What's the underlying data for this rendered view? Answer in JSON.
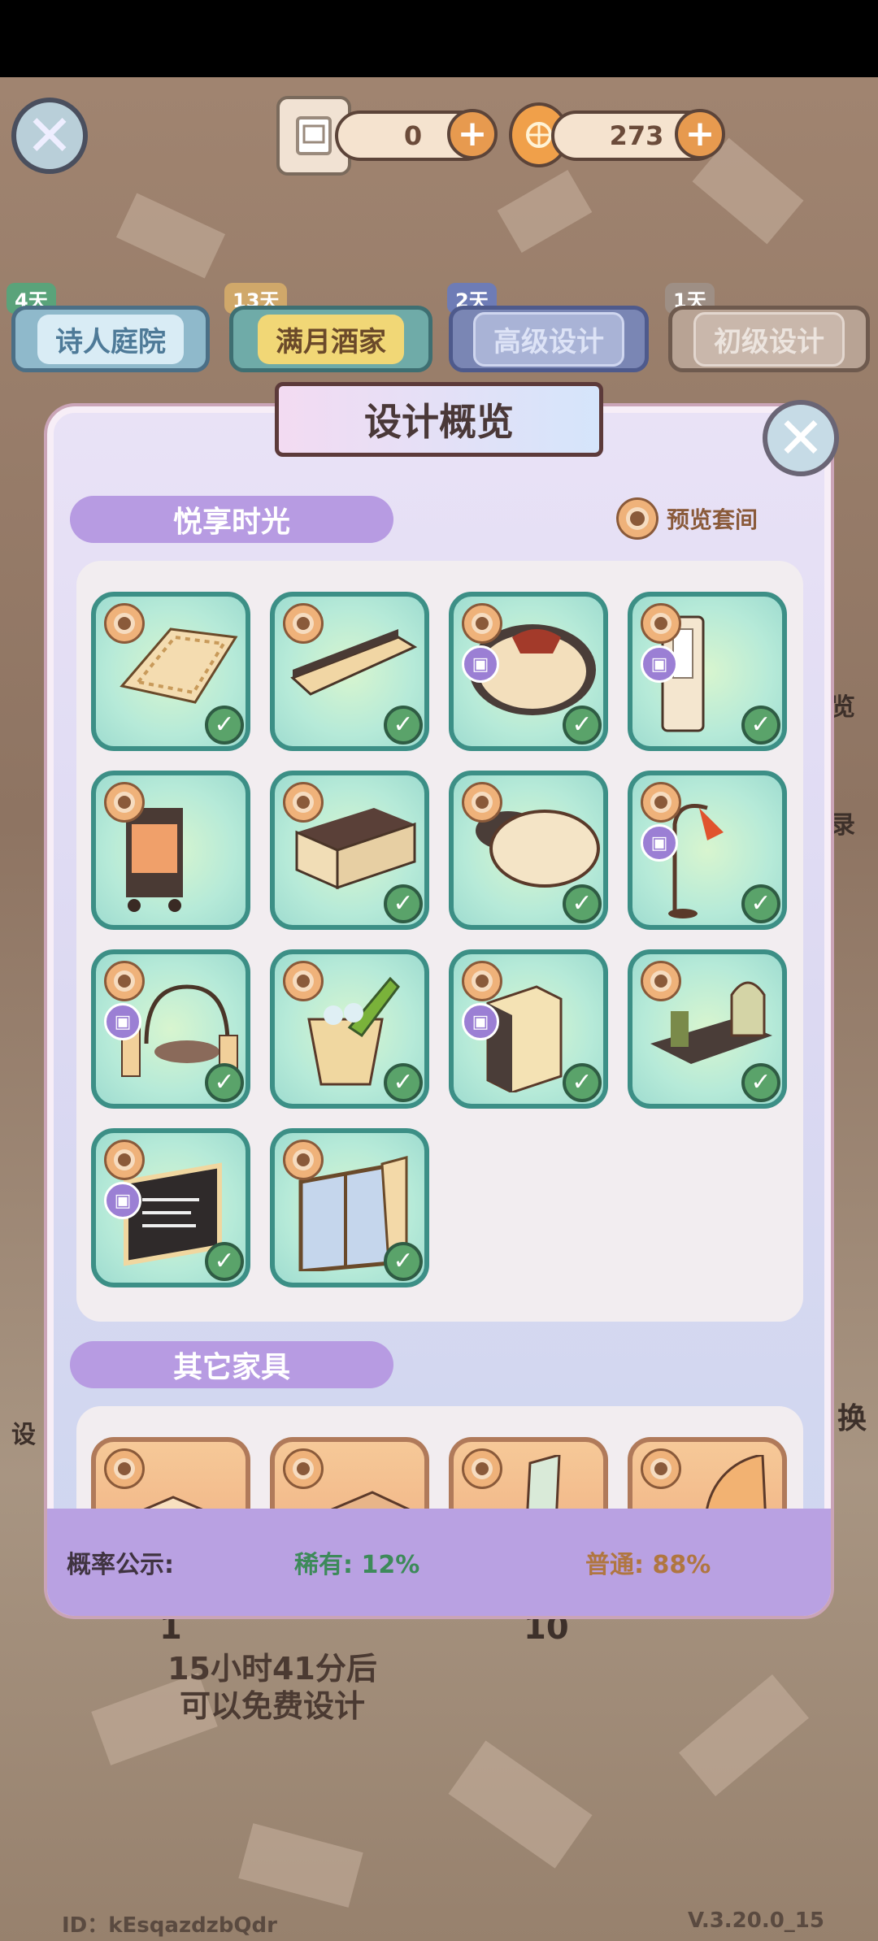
{
  "topbar": {
    "scroll_count": "0",
    "coin_count": "273",
    "close_icon": "close-icon",
    "plus_icon": "plus-icon"
  },
  "tabs": [
    {
      "label": "诗人庭院",
      "days": "4天"
    },
    {
      "label": "满月酒家",
      "days": "13天"
    },
    {
      "label": "高级设计",
      "days": "2天"
    },
    {
      "label": "初级设计",
      "days": "1天"
    }
  ],
  "modal": {
    "title": "设计概览",
    "section1": "悦享时光",
    "preview_label": "预览套间",
    "section2": "其它家具",
    "footer_label": "概率公示:",
    "rare_label": "稀有: 12%",
    "common_label": "普通: 88%"
  },
  "items": [
    {
      "name": "rug",
      "box": false,
      "check": true
    },
    {
      "name": "tv-cabinet",
      "box": false,
      "check": true
    },
    {
      "name": "round-bed",
      "box": true,
      "check": true
    },
    {
      "name": "air-conditioner",
      "box": true,
      "check": true
    },
    {
      "name": "serving-cart",
      "box": false,
      "check": false
    },
    {
      "name": "sideboard",
      "box": false,
      "check": true
    },
    {
      "name": "round-table",
      "box": false,
      "check": true
    },
    {
      "name": "floor-lamp",
      "box": true,
      "check": true
    },
    {
      "name": "candle-lantern",
      "box": true,
      "check": true
    },
    {
      "name": "champagne-bucket",
      "box": false,
      "check": true
    },
    {
      "name": "mini-fridge",
      "box": true,
      "check": true
    },
    {
      "name": "diffuser-tray",
      "box": false,
      "check": true
    },
    {
      "name": "menu-board",
      "box": true,
      "check": true
    },
    {
      "name": "window",
      "box": false,
      "check": true
    }
  ],
  "background": {
    "free_timer": "15小时41分后",
    "free_text": "可以免费设计",
    "count_1": "1",
    "count_10": "10",
    "side_right_1": "览",
    "side_right_2": "录",
    "side_right_3": "换",
    "side_left": "设"
  },
  "footer": {
    "id": "ID：kEsqazdzbQdr",
    "version": "V.3.20.0_15"
  }
}
